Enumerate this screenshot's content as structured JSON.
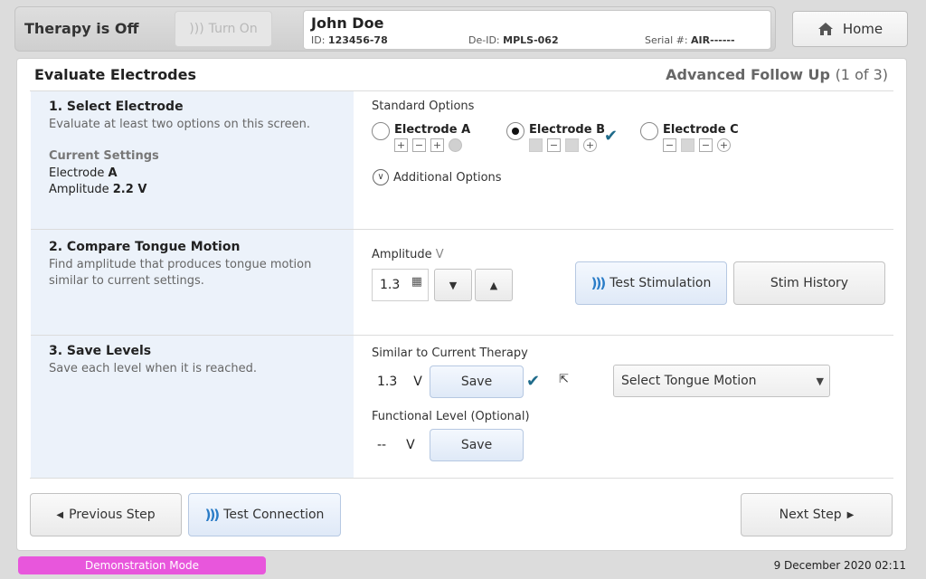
{
  "header": {
    "therapy_status": "Therapy is Off",
    "turn_on_label": "Turn On",
    "home_label": "Home",
    "patient": {
      "name": "John Doe",
      "id_label": "ID:",
      "id": "123456-78",
      "deid_label": "De-ID:",
      "deid": "MPLS-062",
      "serial_label": "Serial #:",
      "serial": "AIR------"
    }
  },
  "panel": {
    "title": "Evaluate Electrodes",
    "mode": "Advanced Follow Up",
    "step_progress": "(1 of 3)"
  },
  "section1": {
    "title": "1. Select Electrode",
    "description": "Evaluate at least two options on this screen.",
    "current_settings_label": "Current Settings",
    "current_electrode_prefix": "Electrode",
    "current_electrode": "A",
    "current_amplitude_prefix": "Amplitude",
    "current_amplitude": "2.2 V",
    "standard_options_label": "Standard Options",
    "electrodes": [
      {
        "label": "Electrode A",
        "selected": false,
        "contacts": [
          "+",
          "−",
          "+",
          "case-filled"
        ]
      },
      {
        "label": "Electrode B",
        "selected": true,
        "contacts": [
          "off",
          "−",
          "off",
          "+"
        ]
      },
      {
        "label": "Electrode C",
        "selected": false,
        "contacts": [
          "−",
          "off",
          "−",
          "+"
        ]
      }
    ],
    "additional_options_label": "Additional Options"
  },
  "section2": {
    "title": "2. Compare Tongue Motion",
    "description": "Find amplitude that produces tongue motion similar to current settings.",
    "amplitude_label": "Amplitude",
    "amplitude_unit": "V",
    "amplitude_value": "1.3",
    "test_stimulation_label": "Test Stimulation",
    "stim_history_label": "Stim History"
  },
  "section3": {
    "title": "3. Save Levels",
    "description": "Save each level when it is reached.",
    "similar_label": "Similar to Current Therapy",
    "similar_value": "1.3",
    "unit": "V",
    "save_label": "Save",
    "tongue_motion_placeholder": "Select Tongue Motion",
    "functional_label": "Functional Level (Optional)",
    "functional_value": "--"
  },
  "footer": {
    "previous_label": "Previous Step",
    "test_connection_label": "Test Connection",
    "next_label": "Next Step"
  },
  "status": {
    "demo_mode": "Demonstration Mode",
    "datetime": "9 December 2020 02:11"
  },
  "colors": {
    "accent_blue": "#2a7cc7",
    "check_teal": "#1f6b8a",
    "demo_pink": "#e856dc",
    "left_column_bg": "#ecf2fa"
  }
}
